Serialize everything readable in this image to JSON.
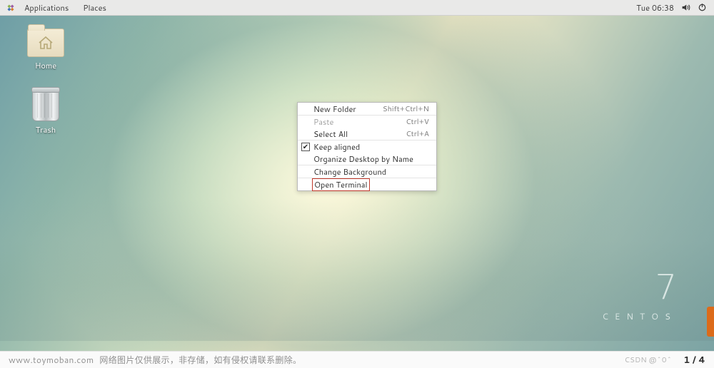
{
  "panel": {
    "applications_label": "Applications",
    "places_label": "Places",
    "clock": "Tue 06:38"
  },
  "desktop": {
    "home_label": "Home",
    "trash_label": "Trash"
  },
  "context_menu": {
    "new_folder": {
      "label": "New Folder",
      "shortcut": "Shift+Ctrl+N"
    },
    "paste": {
      "label": "Paste",
      "shortcut": "Ctrl+V"
    },
    "select_all": {
      "label": "Select All",
      "shortcut": "Ctrl+A"
    },
    "keep_aligned": {
      "label": "Keep aligned",
      "checked": true
    },
    "organize": {
      "label": "Organize Desktop by Name"
    },
    "change_bg": {
      "label": "Change Background"
    },
    "open_terminal": {
      "label": "Open Terminal"
    }
  },
  "brand": {
    "version": "7",
    "name": "CENTOS"
  },
  "watermark": {
    "site": "www.toymoban.com",
    "text": "网络图片仅供展示，非存储，如有侵权请联系删除。",
    "csdn": "CSDN @^0^",
    "pagination": "1 / 4"
  }
}
